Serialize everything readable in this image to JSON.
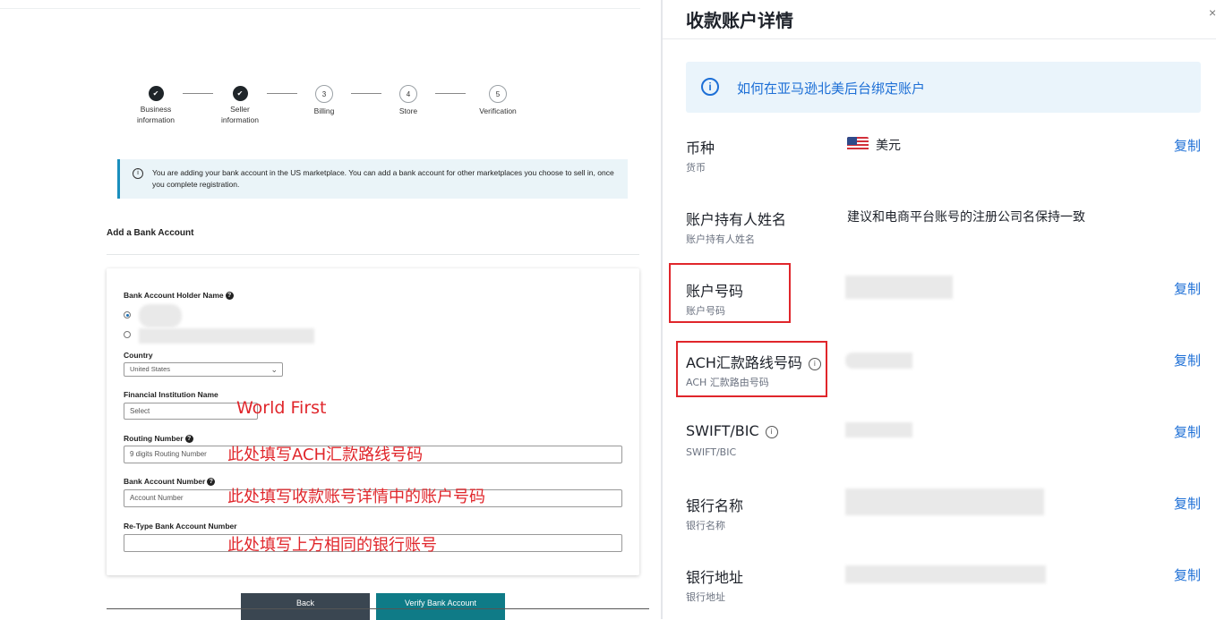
{
  "left": {
    "steps": [
      {
        "num": "",
        "label": "Business\ninformation",
        "done": true
      },
      {
        "num": "",
        "label": "Seller\ninformation",
        "done": true
      },
      {
        "num": "3",
        "label": "Billing",
        "done": false
      },
      {
        "num": "4",
        "label": "Store",
        "done": false
      },
      {
        "num": "5",
        "label": "Verification",
        "done": false
      }
    ],
    "alert_text": "You are adding your bank account in the US marketplace. You can add a bank account for other marketplaces you choose to sell in, once you complete registration.",
    "section_title": "Add a Bank Account",
    "form": {
      "holder_label": "Bank Account Holder Name",
      "country_label": "Country",
      "country_value": "United States",
      "fin_label": "Financial Institution Name",
      "fin_value": "Select",
      "routing_label": "Routing Number",
      "routing_placeholder": "9 digits Routing Number",
      "account_label": "Bank Account Number",
      "account_placeholder": "Account Number",
      "retype_label": "Re-Type Bank Account Number"
    },
    "notes": {
      "fin": "World First",
      "routing": "此处填写ACH汇款路线号码",
      "account": "此处填写收款账号详情中的账户号码",
      "retype": "此处填写上方相同的银行账号"
    },
    "buttons": {
      "back": "Back",
      "verify": "Verify Bank Account"
    }
  },
  "right": {
    "title": "收款账户详情",
    "tip": "如何在亚马逊北美后台绑定账户",
    "copy_label": "复制",
    "rows": [
      {
        "label": "币种",
        "sub": "货币",
        "value": "美元"
      },
      {
        "label": "账户持有人姓名",
        "sub": "账户持有人姓名",
        "value": "建议和电商平台账号的注册公司名保持一致"
      },
      {
        "label": "账户号码",
        "sub": "账户号码",
        "value": ""
      },
      {
        "label": "ACH汇款路线号码",
        "sub": "ACH 汇款路由号码",
        "value": ""
      },
      {
        "label": "SWIFT/BIC",
        "sub": "SWIFT/BIC",
        "value": ""
      },
      {
        "label": "银行名称",
        "sub": "银行名称",
        "value": ""
      },
      {
        "label": "银行地址",
        "sub": "银行地址",
        "value": ""
      }
    ]
  },
  "colors": {
    "highlight": "#e0262b",
    "link": "#1d6fd6",
    "teal_button": "#0f7b87",
    "dark_button": "#3a4651"
  }
}
